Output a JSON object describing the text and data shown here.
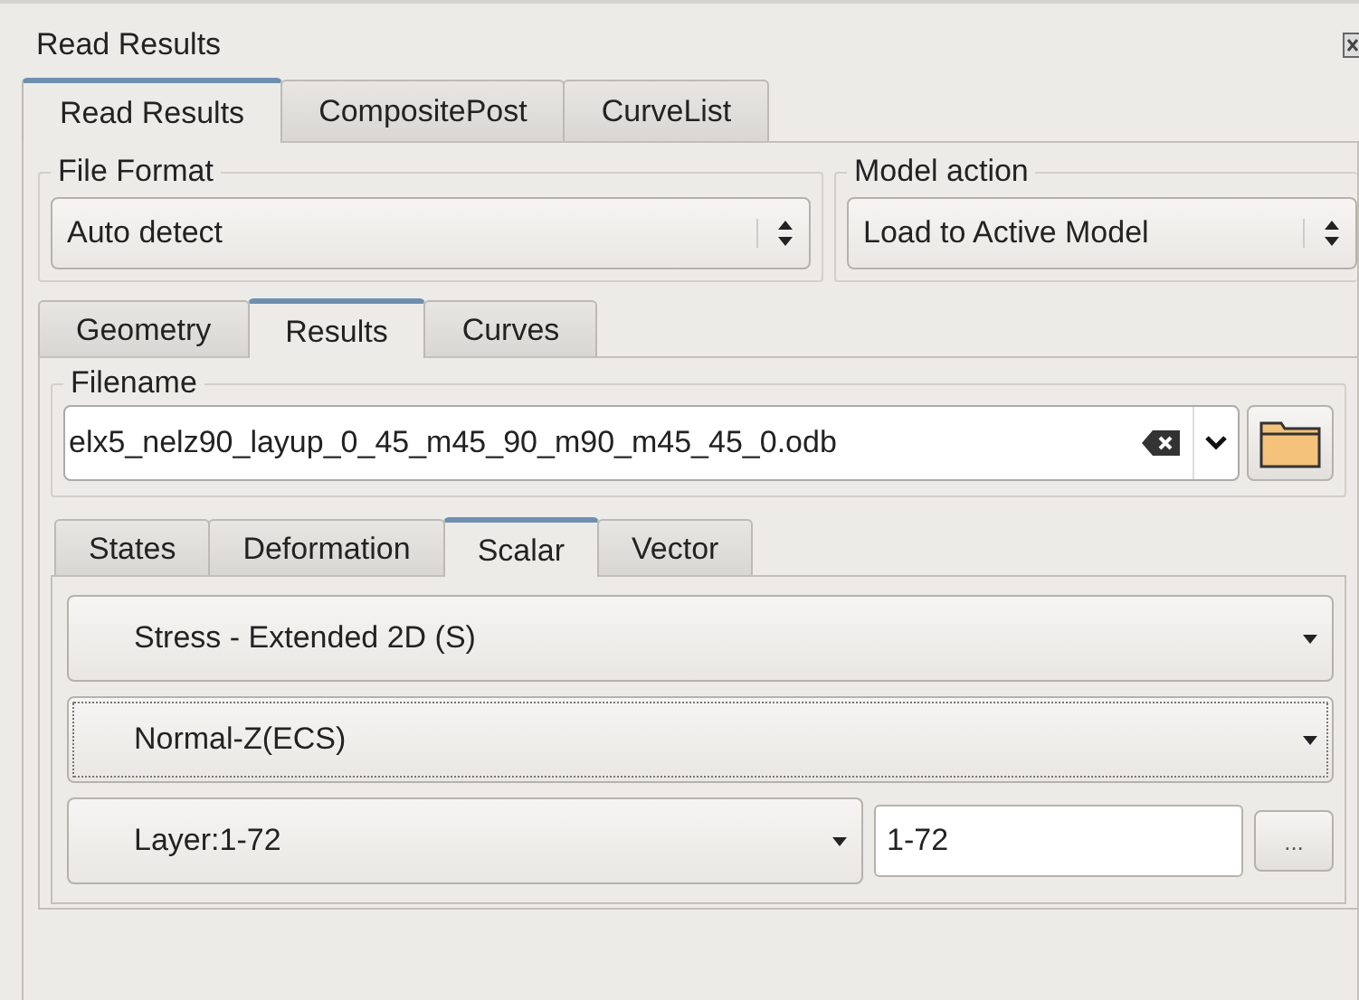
{
  "window": {
    "title": "Read Results"
  },
  "tabs": [
    {
      "label": "Read Results",
      "selected": true
    },
    {
      "label": "CompositePost",
      "selected": false
    },
    {
      "label": "CurveList",
      "selected": false
    }
  ],
  "file_format": {
    "label": "File Format",
    "value": "Auto detect"
  },
  "model_action": {
    "label": "Model action",
    "value": "Load to Active Model"
  },
  "sub_tabs": [
    {
      "label": "Geometry",
      "selected": false
    },
    {
      "label": "Results",
      "selected": true
    },
    {
      "label": "Curves",
      "selected": false
    }
  ],
  "filename": {
    "label": "Filename",
    "value": "elx5_nelz90_layup_0_45_m45_90_m90_m45_45_0.odb"
  },
  "result_tabs": [
    {
      "label": "States",
      "selected": false
    },
    {
      "label": "Deformation",
      "selected": false
    },
    {
      "label": "Scalar",
      "selected": true
    },
    {
      "label": "Vector",
      "selected": false
    }
  ],
  "scalar": {
    "variable": {
      "value": "Stress - Extended 2D  (S)",
      "focused": false
    },
    "component": {
      "value": "Normal-Z(ECS)",
      "focused": true
    },
    "layer": {
      "value": "Layer:1-72",
      "focused": false
    },
    "layer_range": "1-72",
    "browse_button": "..."
  }
}
